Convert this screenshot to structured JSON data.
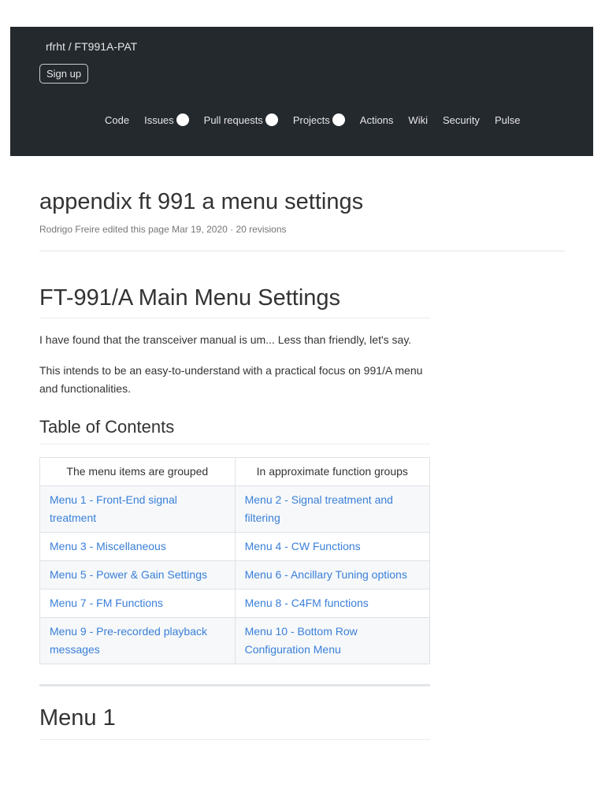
{
  "header": {
    "repo": "rfrht / FT991A-PAT",
    "signup": "Sign up",
    "nav": [
      "Code",
      "Issues",
      "Pull requests",
      "Projects",
      "Actions",
      "Wiki",
      "Security",
      "Pulse"
    ]
  },
  "page": {
    "title": "appendix ft 991 a menu settings",
    "meta": "Rodrigo Freire edited this page Mar 19, 2020 · 20 revisions"
  },
  "content": {
    "h1": "FT-991/A Main Menu Settings",
    "p1": "I have found that the transceiver manual is um... Less than friendly, let's say.",
    "p2": "This intends to be an easy-to-understand with a practical focus on 991/A menu and functionalities.",
    "toc_heading": "Table of Contents",
    "table": {
      "headers": [
        "The menu items are grouped",
        "In approximate function groups"
      ],
      "rows": [
        [
          "Menu 1 - Front-End signal treatment",
          "Menu 2 - Signal treatment and filtering"
        ],
        [
          "Menu 3 - Miscellaneous",
          "Menu 4 - CW Functions"
        ],
        [
          "Menu 5 - Power & Gain Settings",
          "Menu 6 - Ancillary Tuning options"
        ],
        [
          "Menu 7 - FM Functions",
          "Menu 8 - C4FM functions"
        ],
        [
          "Menu 9 - Pre-recorded playback messages",
          "Menu 10 - Bottom Row Configuration Menu"
        ]
      ]
    },
    "menu1": "Menu 1"
  }
}
